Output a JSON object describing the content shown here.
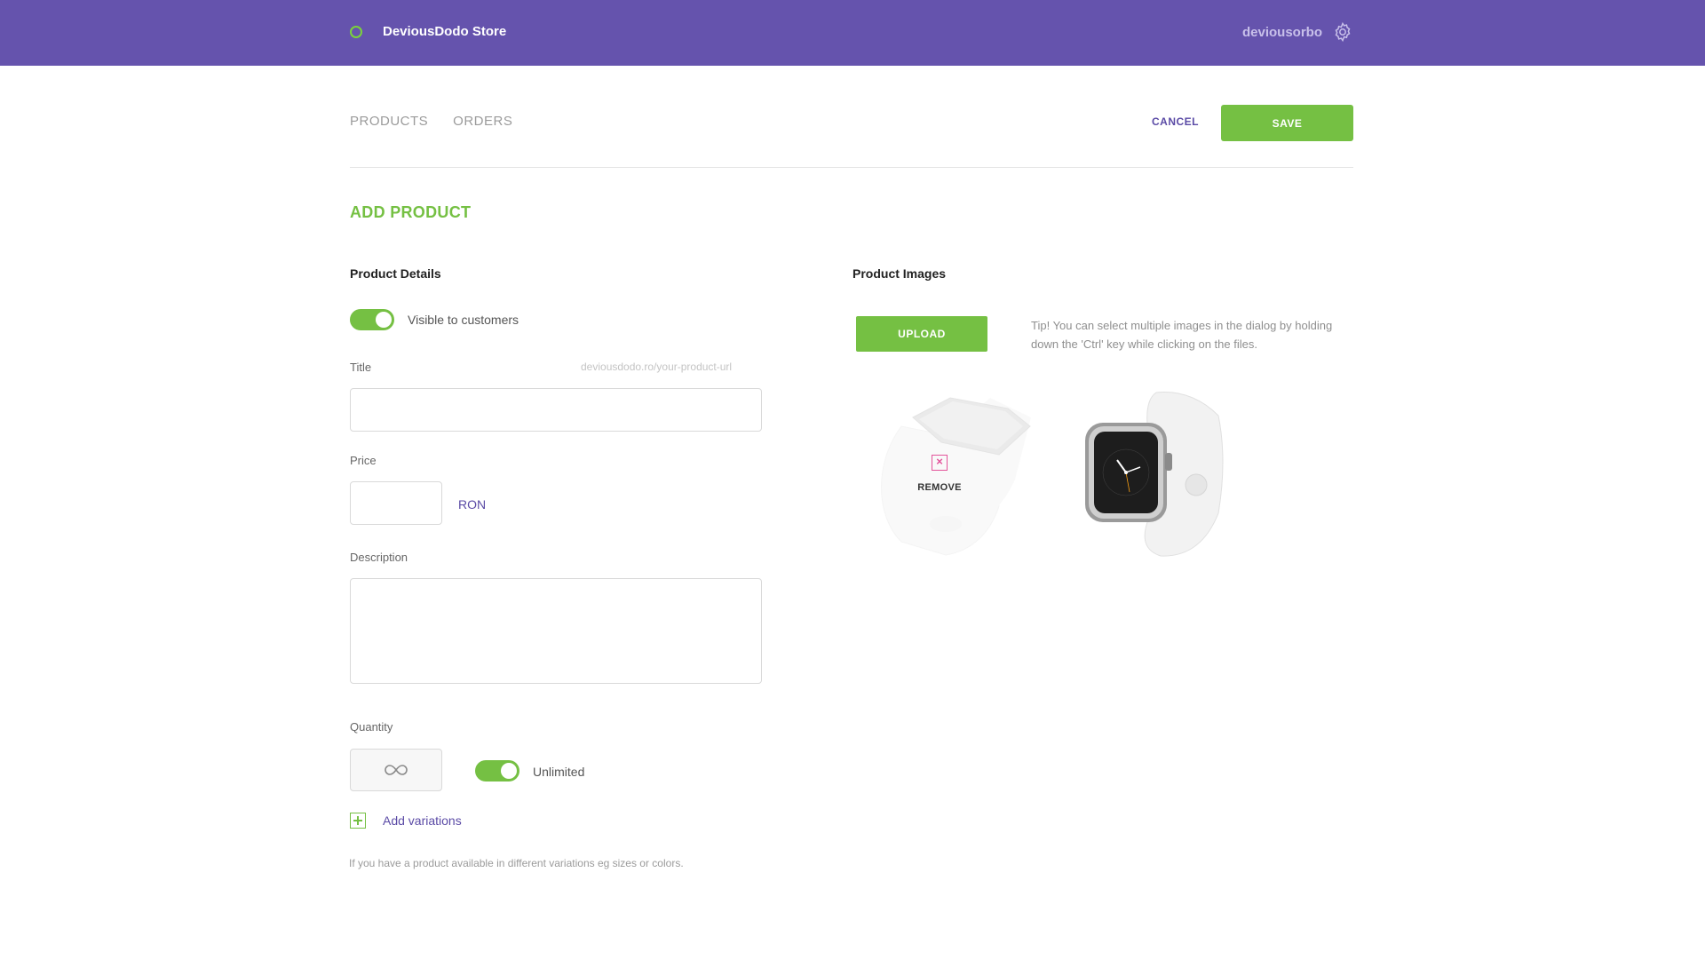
{
  "header": {
    "store_name": "DeviousDodo Store",
    "username": "deviousorbo",
    "brand_color": "#6553ad",
    "logo_icon": "ring-icon",
    "settings_icon": "gear-icon"
  },
  "nav": {
    "tabs": [
      {
        "label": "PRODUCTS"
      },
      {
        "label": "ORDERS"
      }
    ],
    "cancel_label": "CANCEL",
    "save_label": "SAVE"
  },
  "page": {
    "title": "ADD PRODUCT"
  },
  "product_details": {
    "heading": "Product Details",
    "visible_toggle": {
      "label": "Visible to customers",
      "on": true
    },
    "title_field": {
      "label": "Title",
      "url_hint": "deviousdodo.ro/your-product-url",
      "value": ""
    },
    "price_field": {
      "label": "Price",
      "value": "",
      "currency": "RON"
    },
    "description_field": {
      "label": "Description",
      "value": ""
    },
    "quantity": {
      "label": "Quantity",
      "icon": "infinity-icon",
      "unlimited_label": "Unlimited",
      "unlimited_on": true
    },
    "add_variations": {
      "label": "Add variations",
      "icon": "plus-icon"
    },
    "variations_help": "If you have a product available in different variations eg sizes or colors."
  },
  "product_images": {
    "heading": "Product Images",
    "upload_label": "UPLOAD",
    "tip": "Tip! You can select multiple images in the dialog by holding down the 'Ctrl' key while clicking on the files.",
    "images": [
      {
        "description": "white sport band watch, side view",
        "state": "hover",
        "remove_label": "REMOVE"
      },
      {
        "description": "white sport band watch, front view with dial"
      }
    ]
  },
  "colors": {
    "accent_green": "#75c043",
    "link_purple": "#5b4ba6",
    "remove_pink": "#e3549b"
  }
}
